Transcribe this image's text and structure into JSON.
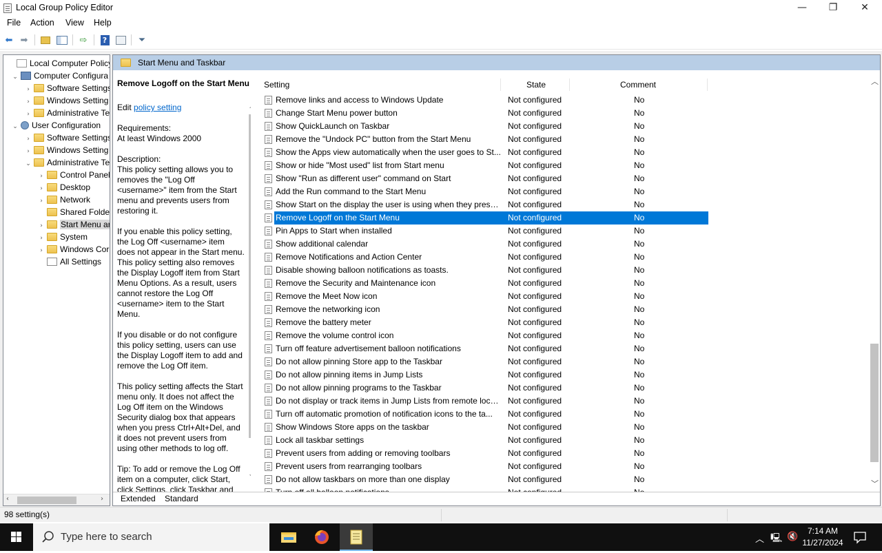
{
  "window": {
    "title": "Local Group Policy Editor",
    "controls": {
      "minimize": "—",
      "restore": "❐",
      "close": "✕"
    }
  },
  "menu": [
    "File",
    "Action",
    "View",
    "Help"
  ],
  "toolbar_icons": [
    "back-arrow-icon",
    "forward-arrow-icon",
    "up-folder-icon",
    "show-hide-tree-icon",
    "export-list-icon",
    "help-icon",
    "properties-icon",
    "filter-icon"
  ],
  "tree": {
    "items": [
      {
        "label": "Local Computer Policy",
        "level": 0,
        "icon": "policy",
        "expander": ""
      },
      {
        "label": "Computer Configura",
        "level": 1,
        "icon": "computer",
        "expander": "⌄"
      },
      {
        "label": "Software Settings",
        "level": 2,
        "icon": "folder",
        "expander": "›"
      },
      {
        "label": "Windows Setting",
        "level": 2,
        "icon": "folder",
        "expander": "›"
      },
      {
        "label": "Administrative Te",
        "level": 2,
        "icon": "folder",
        "expander": "›"
      },
      {
        "label": "User Configuration",
        "level": 1,
        "icon": "user",
        "expander": "⌄"
      },
      {
        "label": "Software Settings",
        "level": 2,
        "icon": "folder",
        "expander": "›"
      },
      {
        "label": "Windows Setting",
        "level": 2,
        "icon": "folder",
        "expander": "›"
      },
      {
        "label": "Administrative Te",
        "level": 2,
        "icon": "folder",
        "expander": "⌄"
      },
      {
        "label": "Control Panel",
        "level": 3,
        "icon": "folder",
        "expander": "›"
      },
      {
        "label": "Desktop",
        "level": 3,
        "icon": "folder",
        "expander": "›"
      },
      {
        "label": "Network",
        "level": 3,
        "icon": "folder",
        "expander": "›"
      },
      {
        "label": "Shared Folder",
        "level": 3,
        "icon": "folder",
        "expander": ""
      },
      {
        "label": "Start Menu ar",
        "level": 3,
        "icon": "folder",
        "expander": "›",
        "selected": true
      },
      {
        "label": "System",
        "level": 3,
        "icon": "folder",
        "expander": "›"
      },
      {
        "label": "Windows Cor",
        "level": 3,
        "icon": "folder",
        "expander": "›"
      },
      {
        "label": "All Settings",
        "level": 3,
        "icon": "settings",
        "expander": ""
      }
    ]
  },
  "header": {
    "title": "Start Menu and Taskbar"
  },
  "description": {
    "title": "Remove Logoff on the Start Menu",
    "edit_prefix": "Edit ",
    "edit_link": "policy setting",
    "requirements_label": "Requirements:",
    "requirements_value": "At least Windows 2000",
    "description_label": "Description:",
    "p1": "This policy setting allows you to removes the \"Log Off <username>\" item from the Start menu and prevents users from restoring it.",
    "p2": "If you enable this policy setting, the Log Off <username> item does not appear in the Start menu. This policy setting also removes the Display Logoff item from Start Menu Options. As a result, users cannot restore the Log Off <username> item to the Start Menu.",
    "p3": "If you disable or do not configure this policy setting, users can use the Display Logoff item to add and remove the Log Off item.",
    "p4": "This policy setting affects the Start menu only. It does not affect the Log Off item on the Windows Security dialog box that appears when you press Ctrl+Alt+Del, and it does not prevent users from using other methods to log off.",
    "p5": "Tip: To add or remove the Log Off item on a computer, click Start, click Settings, click Taskbar and"
  },
  "columns": {
    "setting": "Setting",
    "state": "State",
    "comment": "Comment"
  },
  "settings": [
    {
      "name": "Remove links and access to Windows Update",
      "state": "Not configured",
      "comment": "No"
    },
    {
      "name": "Change Start Menu power button",
      "state": "Not configured",
      "comment": "No"
    },
    {
      "name": "Show QuickLaunch on Taskbar",
      "state": "Not configured",
      "comment": "No"
    },
    {
      "name": "Remove the \"Undock PC\" button from the Start Menu",
      "state": "Not configured",
      "comment": "No"
    },
    {
      "name": "Show the Apps view automatically when the user goes to St...",
      "state": "Not configured",
      "comment": "No"
    },
    {
      "name": "Show or hide \"Most used\" list from Start menu",
      "state": "Not configured",
      "comment": "No"
    },
    {
      "name": "Show \"Run as different user\" command on Start",
      "state": "Not configured",
      "comment": "No"
    },
    {
      "name": "Add the Run command to the Start Menu",
      "state": "Not configured",
      "comment": "No"
    },
    {
      "name": "Show Start on the display the user is using when they press t...",
      "state": "Not configured",
      "comment": "No"
    },
    {
      "name": "Remove Logoff on the Start Menu",
      "state": "Not configured",
      "comment": "No",
      "selected": true
    },
    {
      "name": "Pin Apps to Start when installed",
      "state": "Not configured",
      "comment": "No"
    },
    {
      "name": "Show additional calendar",
      "state": "Not configured",
      "comment": "No"
    },
    {
      "name": "Remove Notifications and Action Center",
      "state": "Not configured",
      "comment": "No"
    },
    {
      "name": "Disable showing balloon notifications as toasts.",
      "state": "Not configured",
      "comment": "No"
    },
    {
      "name": "Remove the Security and Maintenance icon",
      "state": "Not configured",
      "comment": "No"
    },
    {
      "name": "Remove the Meet Now icon",
      "state": "Not configured",
      "comment": "No"
    },
    {
      "name": "Remove the networking icon",
      "state": "Not configured",
      "comment": "No"
    },
    {
      "name": "Remove the battery meter",
      "state": "Not configured",
      "comment": "No"
    },
    {
      "name": "Remove the volume control icon",
      "state": "Not configured",
      "comment": "No"
    },
    {
      "name": "Turn off feature advertisement balloon notifications",
      "state": "Not configured",
      "comment": "No"
    },
    {
      "name": "Do not allow pinning Store app to the Taskbar",
      "state": "Not configured",
      "comment": "No"
    },
    {
      "name": "Do not allow pinning items in Jump Lists",
      "state": "Not configured",
      "comment": "No"
    },
    {
      "name": "Do not allow pinning programs to the Taskbar",
      "state": "Not configured",
      "comment": "No"
    },
    {
      "name": "Do not display or track items in Jump Lists from remote loca...",
      "state": "Not configured",
      "comment": "No"
    },
    {
      "name": "Turn off automatic promotion of notification icons to the ta...",
      "state": "Not configured",
      "comment": "No"
    },
    {
      "name": "Show Windows Store apps on the taskbar",
      "state": "Not configured",
      "comment": "No"
    },
    {
      "name": "Lock all taskbar settings",
      "state": "Not configured",
      "comment": "No"
    },
    {
      "name": "Prevent users from adding or removing toolbars",
      "state": "Not configured",
      "comment": "No"
    },
    {
      "name": "Prevent users from rearranging toolbars",
      "state": "Not configured",
      "comment": "No"
    },
    {
      "name": "Do not allow taskbars on more than one display",
      "state": "Not configured",
      "comment": "No"
    },
    {
      "name": "Turn off all balloon notifications",
      "state": "Not configured",
      "comment": "No"
    }
  ],
  "tabs": {
    "extended": "Extended",
    "standard": "Standard"
  },
  "status": {
    "count": "98 setting(s)"
  },
  "taskbar": {
    "search_placeholder": "Type here to search",
    "time": "7:14 AM",
    "date": "11/27/2024",
    "colors": {
      "bg": "#101010",
      "accent": "#0078d7"
    }
  }
}
